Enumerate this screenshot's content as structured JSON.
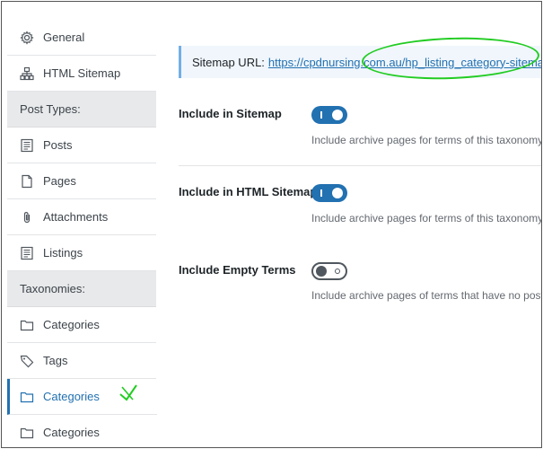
{
  "sidebar": {
    "items": [
      {
        "label": "General",
        "icon": "gear-icon"
      },
      {
        "label": "HTML Sitemap",
        "icon": "sitemap-icon"
      },
      {
        "section": "Post Types:"
      },
      {
        "label": "Posts",
        "icon": "post-icon"
      },
      {
        "label": "Pages",
        "icon": "page-icon"
      },
      {
        "label": "Attachments",
        "icon": "paperclip-icon"
      },
      {
        "label": "Listings",
        "icon": "post-icon"
      },
      {
        "section": "Taxonomies:"
      },
      {
        "label": "Categories",
        "icon": "folder-icon"
      },
      {
        "label": "Tags",
        "icon": "tag-icon"
      },
      {
        "label": "Categories",
        "icon": "folder-icon",
        "active": true
      },
      {
        "label": "Categories",
        "icon": "folder-icon"
      }
    ]
  },
  "sitemap": {
    "label": "Sitemap URL:",
    "url": "https://cpdnursing.com.au/hp_listing_category-sitemap.xml"
  },
  "settings": [
    {
      "label": "Include in Sitemap",
      "enabled": true,
      "help": "Include archive pages for terms of this taxonomy"
    },
    {
      "label": "Include in HTML Sitemap",
      "enabled": true,
      "help": "Include archive pages for terms of this taxonomy"
    },
    {
      "label": "Include Empty Terms",
      "enabled": false,
      "help": "Include archive pages of terms that have no post"
    }
  ],
  "colors": {
    "accent": "#2271b1",
    "annotation": "#22cc22"
  }
}
